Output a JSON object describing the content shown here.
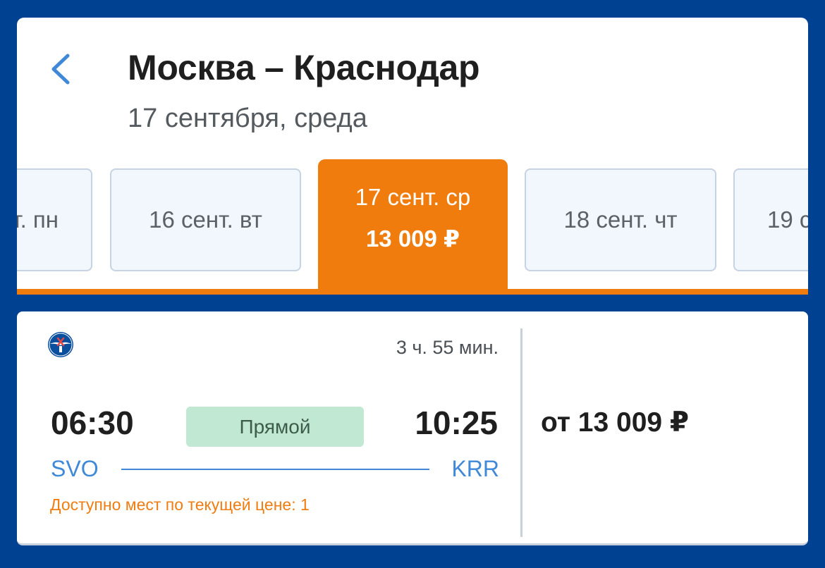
{
  "header": {
    "title": "Москва – Краснодар",
    "subtitle": "17 сентября, среда"
  },
  "date_tabs": [
    {
      "label": "т. пн"
    },
    {
      "label": "16 сент. вт"
    },
    {
      "label": "17 сент. ср",
      "price": "13 009 ₽",
      "selected": true
    },
    {
      "label": "18 сент. чт"
    },
    {
      "label": "19 с"
    }
  ],
  "flight": {
    "airline_logo": "aeroflot-logo",
    "duration": "3 ч. 55 мин.",
    "departure_time": "06:30",
    "arrival_time": "10:25",
    "type_badge": "Прямой",
    "departure_code": "SVO",
    "arrival_code": "KRR",
    "seats_note": "Доступно мест по текущей цене: 1",
    "price_from": "от 13 009 ₽"
  },
  "colors": {
    "background": "#004192",
    "accent_orange": "#f17c0e",
    "link_blue": "#3f89d8",
    "badge_green": "#c1e8d3"
  }
}
